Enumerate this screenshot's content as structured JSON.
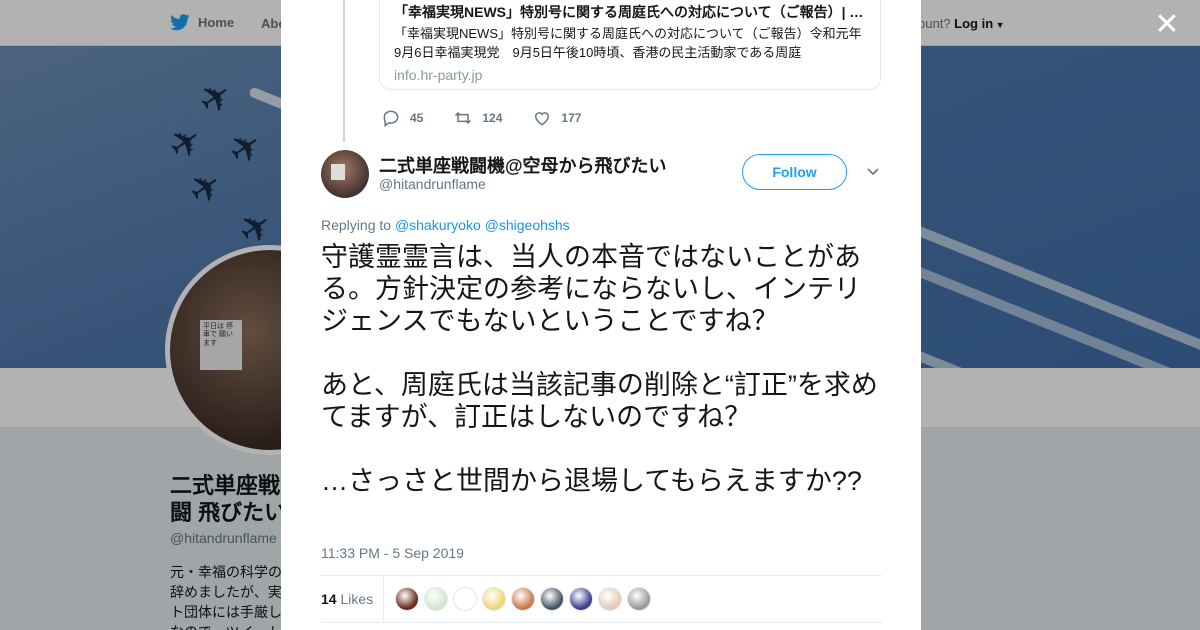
{
  "topbar": {
    "home_label": "Home",
    "about_label": "Abo",
    "account_prompt": "ccount?",
    "login_label": "Log in"
  },
  "profile": {
    "name": "二式単座戦闘機@空母から飛びたい",
    "name_visible": "二式単座戦闘 飛びたい",
    "handle": "@hitandrunflame",
    "bio": "元・幸福の科学の 辞めましたが、実 ト団体には手厳し なので、ツイート"
  },
  "card": {
    "title": "「幸福実現NEWS」特別号に関する周庭氏への対応について（ご報告）| …",
    "description": "「幸福実現NEWS」特別号に関する周庭氏への対応について（ご報告）令和元年9月6日幸福実現党　9月5日午後10時頃、香港の民主活動家である周庭",
    "domain": "info.hr-party.jp"
  },
  "parent_actions": {
    "replies": "45",
    "retweets": "124",
    "likes": "177"
  },
  "tweet": {
    "author_name": "二式単座戦闘機@空母から飛びたい",
    "author_handle": "@hitandrunflame",
    "follow_label": "Follow",
    "replying_prefix": "Replying to",
    "mention_1": "@shakuryoko",
    "mention_2": "@shigeohshs",
    "paragraphs": [
      "守護霊霊言は、当人の本音ではないことがある。方針決定の参考にならないし、インテリジェンスでもないということですね？",
      "あと、周庭氏は当該記事の削除と“訂正”を求めてますが、訂正はしないのですね？",
      "…さっさと世間から退場してもらえますか??"
    ],
    "timestamp": "11:33 PM - 5 Sep 2019",
    "likes_count": "14",
    "likes_label": "Likes"
  },
  "icons": {
    "brand": "twitter-bird-icon",
    "close": "close-icon",
    "reply": "reply-icon",
    "retweet": "retweet-icon",
    "like": "heart-icon",
    "menu": "chevron-down-icon"
  },
  "colors": {
    "accent": "#1da1f2",
    "link": "#1b95e0",
    "muted": "#657786",
    "text": "#14171a"
  },
  "liker_avatar_colors": [
    "#6b2a1a",
    "#cfe8c8",
    "#ffffff",
    "#f2d27a",
    "#c9784a",
    "#445566",
    "#3a3f8f",
    "#e6c9b8",
    "#9a9a9a"
  ]
}
